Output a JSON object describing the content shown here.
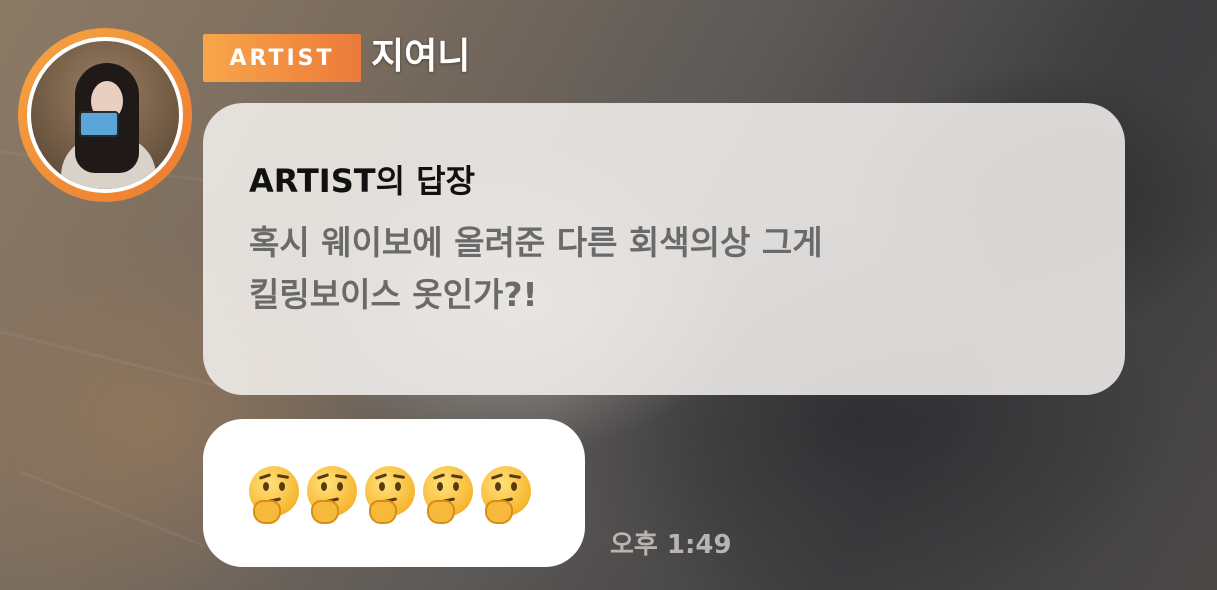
{
  "header": {
    "badge_label": "ARTIST",
    "artist_name": "지여니",
    "avatar_icon": "artist-avatar-photo",
    "accent_colors": [
      "#f7a64a",
      "#ec7a3a"
    ]
  },
  "reply": {
    "title": "ARTIST의 답장",
    "lines": [
      "혹시 웨이보에 올려준 다른 회색의상 그게",
      "킬링보이스 옷인가?!"
    ]
  },
  "message": {
    "emojis": [
      "🤔",
      "🤔",
      "🤔",
      "🤔",
      "🤔"
    ],
    "emoji_icon": "thinking-face-icon",
    "time": "오후 1:49"
  }
}
